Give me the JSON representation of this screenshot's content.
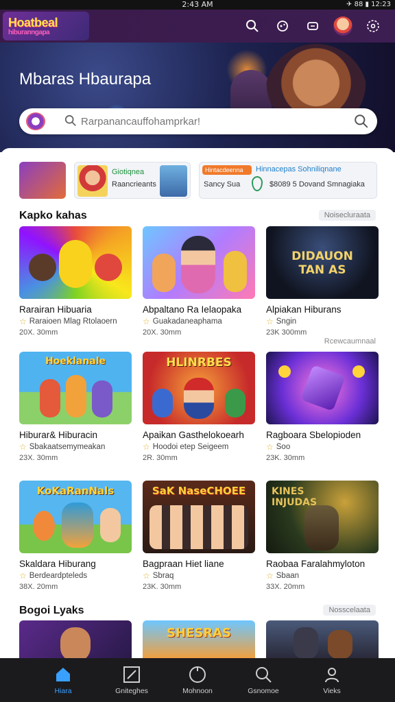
{
  "status": {
    "time": "2:43 AM",
    "system": "✈ 88 ▮ 12:23"
  },
  "app": {
    "logo_line1": "Hoatbeal",
    "logo_line2": "hiburanngapa"
  },
  "hero": {
    "title": "Mbaras Hbaurapa"
  },
  "search": {
    "placeholder": "Rarpanancauffohamprkar!"
  },
  "promo": {
    "card2_line1": "Giotiqnea",
    "card2_line2": "Raancrieants",
    "card3_badge": "Hintacdeenna",
    "card3_line1": "Hinnacepas Sohniliqnane",
    "card3_line2": "Sancy Sua",
    "card3_line3": "$8089 5  Dovand Smnagiaka"
  },
  "sections": [
    {
      "title": "Kapko kahas",
      "see_all": "Noisecluraata"
    },
    {
      "title": "Bogoi Lyaks",
      "see_all": "Nosscelaata"
    }
  ],
  "row_link": "Rcewcaumnaal",
  "tiles": [
    {
      "title": "Rarairan Hibuaria",
      "meta": "Raraioen Mlag Rtolaoern",
      "size": "20X. 30mm"
    },
    {
      "title": "Abpaltano Ra Ielaopaka",
      "meta": "Guakadaneaphama",
      "size": "20X. 30mm"
    },
    {
      "title": "Alpiakan Hiburans",
      "meta": "Sngin",
      "size": "23K 300mm"
    },
    {
      "title": "Hiburar& Hiburacin",
      "meta": "Sbakaatsemymeakan",
      "size": "23X. 30mm"
    },
    {
      "title": "Apaikan Gasthelokoearh",
      "meta": "Hoodoi etep Seigeem",
      "size": "2R. 30mm"
    },
    {
      "title": "Ragboara Sbelopioden",
      "meta": "Soo",
      "size": "23K. 30mm"
    },
    {
      "title": "Skaldara Hiburang",
      "meta": "Berdeardpteleds",
      "size": "38X. 20mm"
    },
    {
      "title": "Bagpraan Hiet liane",
      "meta": "Sbraq",
      "size": "23K. 30mm"
    },
    {
      "title": "Raobaa Faralahmyloton",
      "meta": "Sbaan",
      "size": "33X. 20mm"
    }
  ],
  "thumb_words": [
    "",
    "",
    "DIDAUON TAN AS",
    "Hoeklanale",
    "HLINRBES",
    "",
    "KoKaRanNals",
    "SaK NaseCHOEE",
    "KINES INJUDAS",
    "",
    "SHESRAS",
    ""
  ],
  "nav": [
    {
      "label": "Hiara",
      "active": true
    },
    {
      "label": "Gniteghes",
      "active": false
    },
    {
      "label": "Mohnoon",
      "active": false
    },
    {
      "label": "Gsnomoe",
      "active": false
    },
    {
      "label": "Vieks",
      "active": false
    }
  ],
  "colors": {
    "accent": "#3aa0ff",
    "appbar": "#3a1a4a",
    "star": "#e0b12a"
  }
}
